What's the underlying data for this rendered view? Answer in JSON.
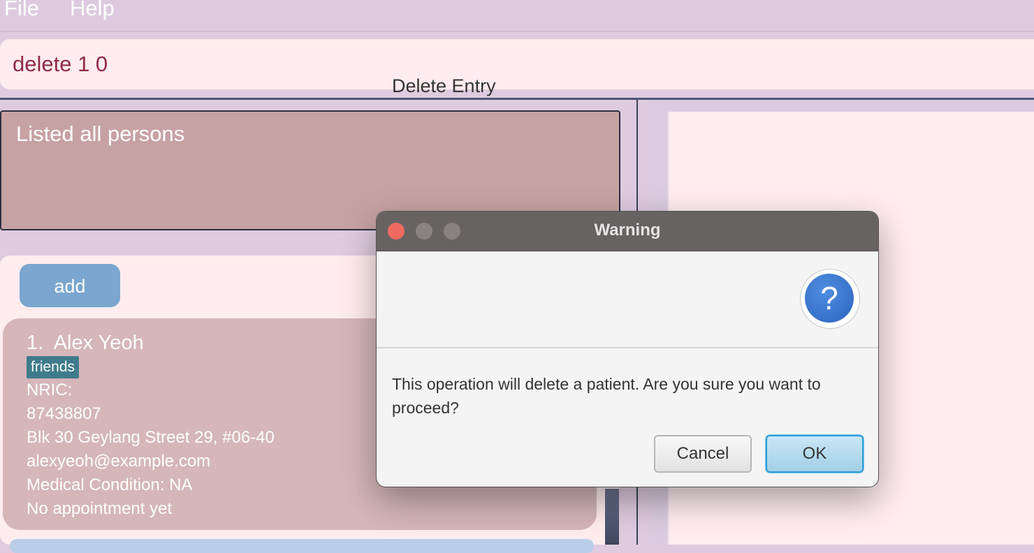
{
  "menu": {
    "file": "File",
    "help": "Help"
  },
  "command_box": {
    "value": "delete 1 0"
  },
  "result_display": {
    "text": "Listed all persons"
  },
  "list": {
    "add_label": "add",
    "persons": [
      {
        "index": "1.",
        "name": "Alex Yeoh",
        "tag": "friends",
        "nric": "NRIC:",
        "phone": "87438807",
        "address": "Blk 30 Geylang Street 29, #06-40",
        "email": "alexyeoh@example.com",
        "condition": "Medical Condition: NA",
        "appointment": "No appointment yet"
      }
    ]
  },
  "dialog": {
    "title": "Warning",
    "header": "Delete Entry",
    "message": "This operation will delete a patient. Are you sure you want to proceed?",
    "cancel_label": "Cancel",
    "ok_label": "OK",
    "icon": "question-icon",
    "icon_glyph": "?"
  },
  "colors": {
    "background": "#dfcbe0",
    "command_text": "#8e2a47",
    "result_bg": "#c7a2a3",
    "card_bg": "#d5b6b9",
    "tag_bg": "#3f7b8c",
    "add_button": "#7aa6cf",
    "dialog_title_bar": "#676362",
    "ok_border": "#2c9ed9"
  }
}
